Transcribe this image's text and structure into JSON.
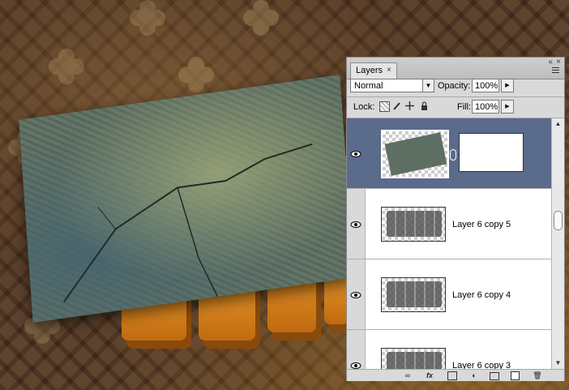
{
  "panel": {
    "tab_label": "Layers",
    "tab_close": "×",
    "collapse_glyph": "«",
    "close_glyph": "×",
    "blend_mode": "Normal",
    "opacity_label": "Opacity:",
    "opacity_value": "100%",
    "lock_label": "Lock:",
    "fill_label": "Fill:",
    "fill_value": "100%"
  },
  "layers": [
    {
      "name": "",
      "selected": true,
      "has_mask": true
    },
    {
      "name": "Layer 6 copy 5",
      "selected": false
    },
    {
      "name": "Layer 6 copy 4",
      "selected": false
    },
    {
      "name": "Layer 6 copy 3",
      "selected": false
    }
  ],
  "bottom_icons": [
    "link-layers-icon",
    "fx-icon",
    "add-mask-icon",
    "adjustment-icon",
    "new-group-icon",
    "new-layer-icon",
    "trash-icon"
  ],
  "bottom_labels": {
    "fx": "fx"
  },
  "colors": {
    "selected_row": "#5a6b8c",
    "panel_bg": "#d9d9d9"
  }
}
